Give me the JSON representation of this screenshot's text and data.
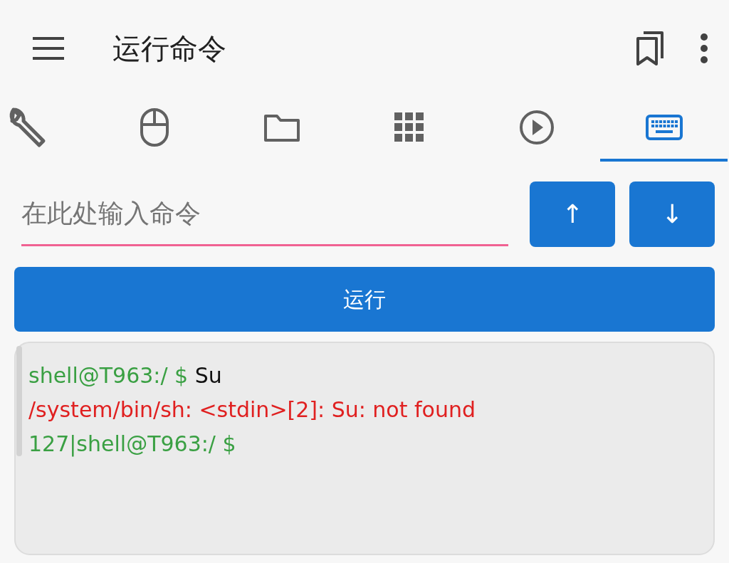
{
  "app_bar": {
    "title": "运行命令"
  },
  "tabs": [
    {
      "kind": "wrench",
      "selected": false
    },
    {
      "kind": "mouse",
      "selected": false
    },
    {
      "kind": "folder",
      "selected": false
    },
    {
      "kind": "grid",
      "selected": false
    },
    {
      "kind": "play",
      "selected": false
    },
    {
      "kind": "keyboard",
      "selected": true
    }
  ],
  "command_field": {
    "placeholder": "在此处输入命令"
  },
  "history_buttons": [
    "↑",
    "↓"
  ],
  "run_button": "运行",
  "terminal": {
    "lines": [
      [
        {
          "kind": "prompt",
          "text": "shell@T963:/ $"
        },
        {
          "kind": "input",
          "text": "Su"
        }
      ],
      [
        {
          "kind": "error",
          "text": "/system/bin/sh: <stdin>[2]: Su: not found"
        }
      ],
      [
        {
          "kind": "prompt",
          "text": "127|shell@T963:/ $"
        }
      ]
    ]
  }
}
